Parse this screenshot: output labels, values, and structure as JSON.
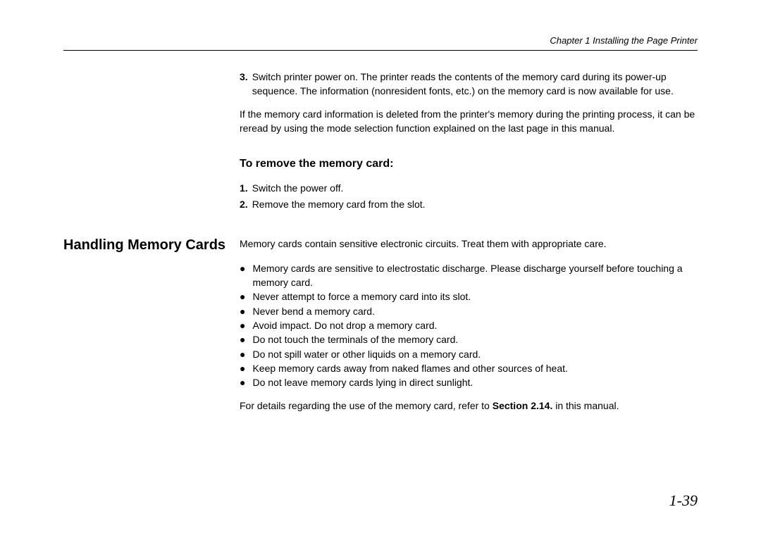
{
  "header": {
    "chapter_label": "Chapter 1 Installing the Page Printer"
  },
  "step3": {
    "number": "3.",
    "text": "Switch printer power on. The printer reads the contents of the memory card during its power-up sequence. The information (nonresident fonts, etc.) on the memory card is now available for use."
  },
  "note_para": "If the memory card information is deleted from the printer's memory during the printing process, it can be reread by using the mode selection function explained on the last page in this manual.",
  "remove_section": {
    "heading": "To remove the memory card:",
    "steps": [
      {
        "number": "1.",
        "text": "Switch the power off."
      },
      {
        "number": "2.",
        "text": "Remove the memory card from the slot."
      }
    ]
  },
  "handling_section": {
    "heading": "Handling Memory Cards",
    "intro": "Memory cards contain sensitive electronic circuits. Treat them with appropriate care.",
    "bullets": [
      "Memory cards are sensitive to electrostatic discharge. Please discharge yourself before touching a memory card.",
      "Never attempt to force a memory card into its slot.",
      "Never bend a memory card.",
      "Avoid impact. Do not drop a memory card.",
      "Do not touch the terminals of the memory card.",
      "Do not spill water or other liquids on a memory card.",
      "Keep memory cards away from naked flames and other sources of heat.",
      "Do not leave memory cards lying in direct sunlight."
    ],
    "details_prefix": "For details regarding the use of the memory card, refer to ",
    "details_ref": "Section 2.14.",
    "details_suffix": " in this manual."
  },
  "page_number": "1-39"
}
